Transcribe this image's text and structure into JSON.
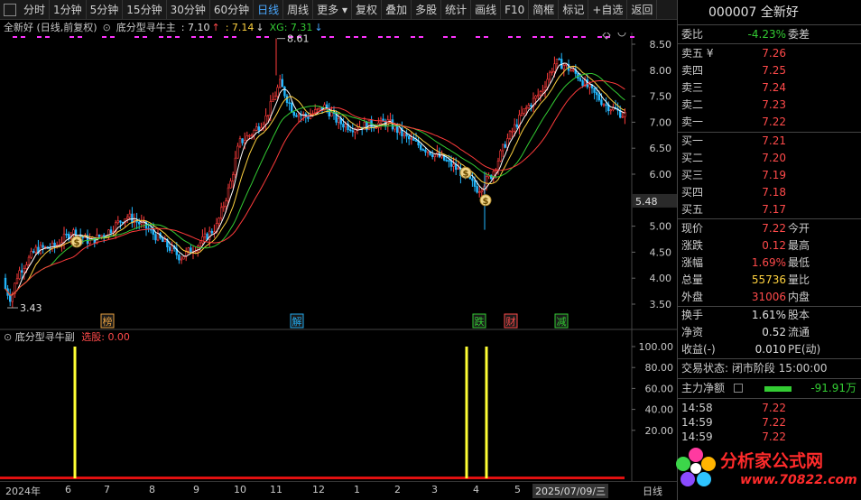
{
  "toolbar": {
    "period_buttons": [
      "分时",
      "1分钟",
      "5分钟",
      "15分钟",
      "30分钟",
      "60分钟",
      "日线",
      "周线",
      "更多"
    ],
    "active_period": "日线",
    "tool_buttons": [
      "复权",
      "叠加",
      "多股",
      "统计",
      "画线",
      "F10",
      "简框",
      "标记",
      "+自选",
      "返回"
    ]
  },
  "chart_header": {
    "stock_title": "全新好 (日线,前复权)",
    "indicator_name": "底分型寻牛主",
    "v1": ": 7.10",
    "v2": ": 7.14",
    "xg": "XG: 7.31"
  },
  "main_axis": {
    "labels": [
      "8.50",
      "8.00",
      "7.50",
      "7.00",
      "6.50",
      "6.00",
      "5.50",
      "5.00",
      "4.50",
      "4.00",
      "3.50"
    ],
    "current_label": "5.48",
    "high_label": "8.61",
    "low_label": "3.43"
  },
  "chart_markers": [
    {
      "text": "榜",
      "color": "#e8a040"
    },
    {
      "text": "解",
      "color": "#22aaee"
    },
    {
      "text": "跌",
      "color": "#33cc33"
    },
    {
      "text": "财",
      "color": "#ff4a4a"
    },
    {
      "text": "减",
      "color": "#33cc33"
    }
  ],
  "sub_chart": {
    "name": "底分型寻牛副",
    "selected_label": "选股:",
    "selected_value": "0.00",
    "axis_labels": [
      "100.00",
      "80.00",
      "60.00",
      "40.00",
      "20.00"
    ]
  },
  "x_axis": {
    "ticks": [
      "2024年",
      "6",
      "7",
      "8",
      "9",
      "10",
      "11",
      "12",
      "1",
      "2",
      "3",
      "4",
      "5"
    ],
    "date_label": "2025/07/09/三",
    "period_label": "日线"
  },
  "quote_panel": {
    "code_name": "000007 全新好",
    "weibi_label": "委比",
    "weibi_value": "-4.23%",
    "weicha_label": "委差",
    "sell_rows": [
      {
        "label": "卖五 ¥",
        "price": "7.26"
      },
      {
        "label": "卖四",
        "price": "7.25"
      },
      {
        "label": "卖三",
        "price": "7.24"
      },
      {
        "label": "卖二",
        "price": "7.23"
      },
      {
        "label": "卖一",
        "price": "7.22"
      }
    ],
    "buy_rows": [
      {
        "label": "买一",
        "price": "7.21"
      },
      {
        "label": "买二",
        "price": "7.20"
      },
      {
        "label": "买三",
        "price": "7.19"
      },
      {
        "label": "买四",
        "price": "7.18"
      },
      {
        "label": "买五",
        "price": "7.17"
      }
    ],
    "stats": [
      {
        "l1": "现价",
        "v1": "7.22",
        "l2": "今开"
      },
      {
        "l1": "涨跌",
        "v1": "0.12",
        "l2": "最高"
      },
      {
        "l1": "涨幅",
        "v1": "1.69%",
        "l2": "最低"
      },
      {
        "l1": "总量",
        "v1": "55736",
        "l2": "量比"
      },
      {
        "l1": "外盘",
        "v1": "31006",
        "l2": "内盘"
      }
    ],
    "stats2": [
      {
        "l1": "换手",
        "v1": "1.61%",
        "l2": "股本"
      },
      {
        "l1": "净资",
        "v1": "0.52",
        "l2": "流通"
      },
      {
        "l1": "收益(-)",
        "v1": "0.010",
        "l2": "PE(动)"
      }
    ],
    "trade_status": "交易状态: 闭市阶段 15:00:00",
    "main_flow_label": "主力净额",
    "main_flow_value": "-91.91万",
    "ticks": [
      {
        "time": "14:58",
        "price": "7.22"
      },
      {
        "time": "14:59",
        "price": "7.22"
      },
      {
        "time": "14:59",
        "price": "7.22"
      }
    ]
  },
  "logo": {
    "name": "分析家公式网",
    "url": "www.70822.com"
  }
}
